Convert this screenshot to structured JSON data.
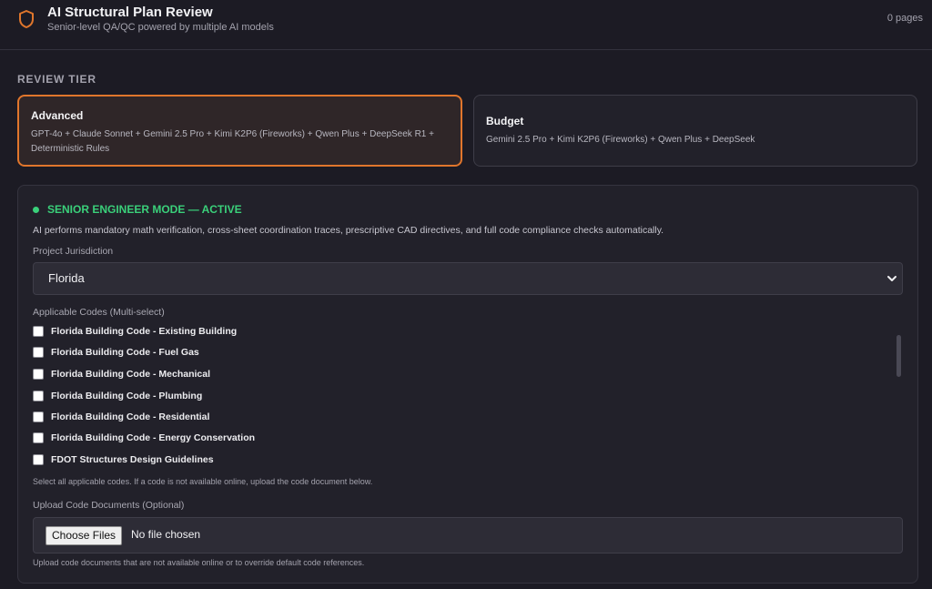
{
  "header": {
    "title": "AI Structural Plan Review",
    "subtitle": "Senior-level QA/QC powered by multiple AI models",
    "page_count": "0 pages",
    "logo_icon": "shield-icon",
    "accent_color": "#e0762c"
  },
  "review_tier": {
    "section_label": "REVIEW TIER",
    "selected": "Advanced",
    "tiers": [
      {
        "name": "Advanced",
        "description": "GPT-4o + Claude Sonnet + Gemini 2.5 Pro + Kimi K2P6 (Fireworks) + Qwen Plus + DeepSeek R1 + Deterministic Rules"
      },
      {
        "name": "Budget",
        "description": "Gemini 2.5 Pro + Kimi K2P6 (Fireworks) + Qwen Plus + DeepSeek"
      }
    ]
  },
  "senior_mode": {
    "title": "SENIOR ENGINEER MODE — ACTIVE",
    "status_color": "#3ad07a",
    "description": "AI performs mandatory math verification, cross-sheet coordination traces, prescriptive CAD directives, and full code compliance checks automatically.",
    "jurisdiction_label": "Project Jurisdiction",
    "jurisdiction_value": "Florida",
    "codes_label": "Applicable Codes (Multi-select)",
    "codes": [
      "Florida Building Code - Existing Building",
      "Florida Building Code - Fuel Gas",
      "Florida Building Code - Mechanical",
      "Florida Building Code - Plumbing",
      "Florida Building Code - Residential",
      "Florida Building Code - Energy Conservation",
      "FDOT Structures Design Guidelines"
    ],
    "codes_hint": "Select all applicable codes. If a code is not available online, upload the code document below.",
    "upload_label": "Upload Code Documents (Optional)",
    "upload_button": "Choose Files",
    "upload_status": "No file chosen",
    "upload_hint": "Upload code documents that are not available online or to override default code references."
  }
}
